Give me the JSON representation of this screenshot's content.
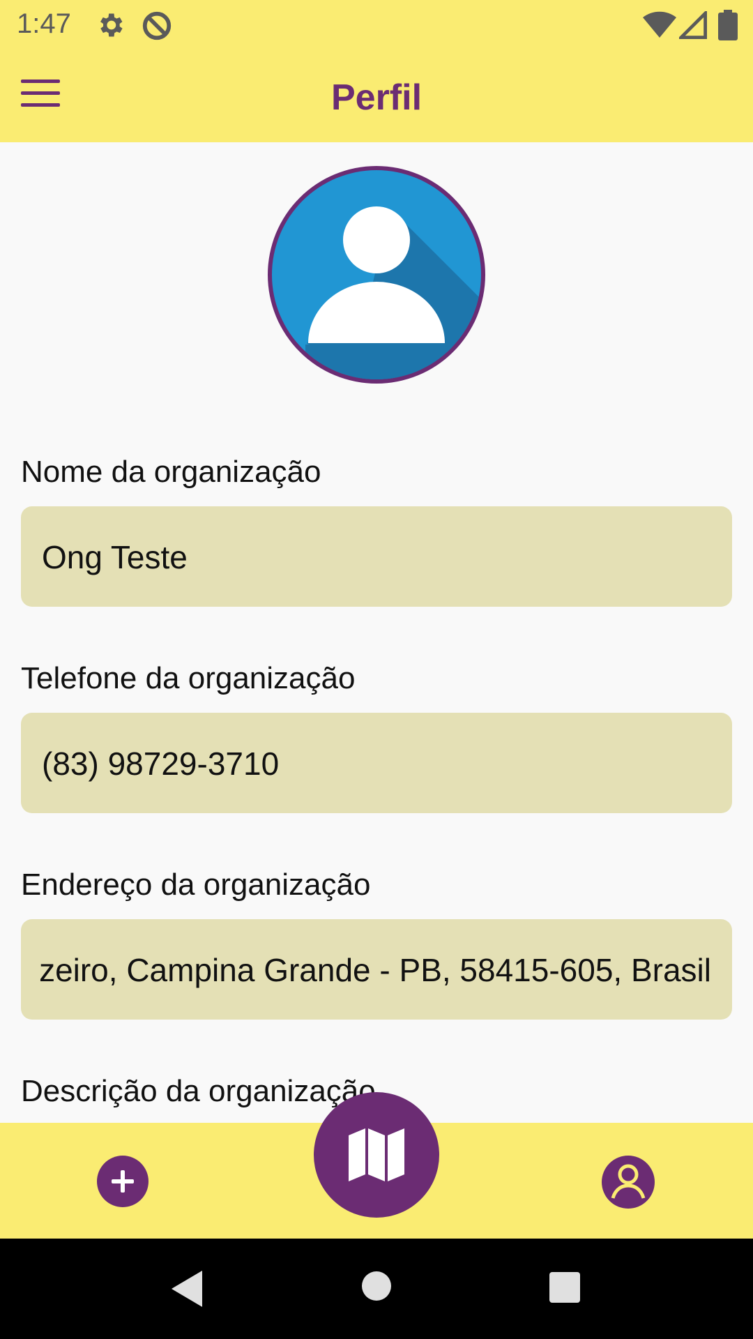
{
  "status_bar": {
    "time": "1:47",
    "icons_left": [
      "settings-icon",
      "data-saver-icon"
    ],
    "icons_right": [
      "wifi-icon",
      "signal-icon",
      "battery-icon"
    ]
  },
  "app_bar": {
    "title": "Perfil",
    "menu_icon": "hamburger-menu-icon"
  },
  "profile": {
    "avatar_icon": "user-avatar-icon"
  },
  "form": {
    "name_label": "Nome da organização",
    "name_value": "Ong Teste",
    "phone_label": "Telefone da organização",
    "phone_value": "(83) 98729-3710",
    "address_label": "Endereço da organização",
    "address_value": "zeiro, Campina Grande - PB, 58415-605, Brasil",
    "description_label": "Descrição da organização"
  },
  "bottom_nav": {
    "items": [
      "add-icon",
      "map-icon",
      "profile-icon"
    ]
  },
  "colors": {
    "bar_yellow": "#faec72",
    "purple": "#6b2c73",
    "field_bg": "#e4e0b5",
    "avatar_blue": "#2196d3"
  }
}
